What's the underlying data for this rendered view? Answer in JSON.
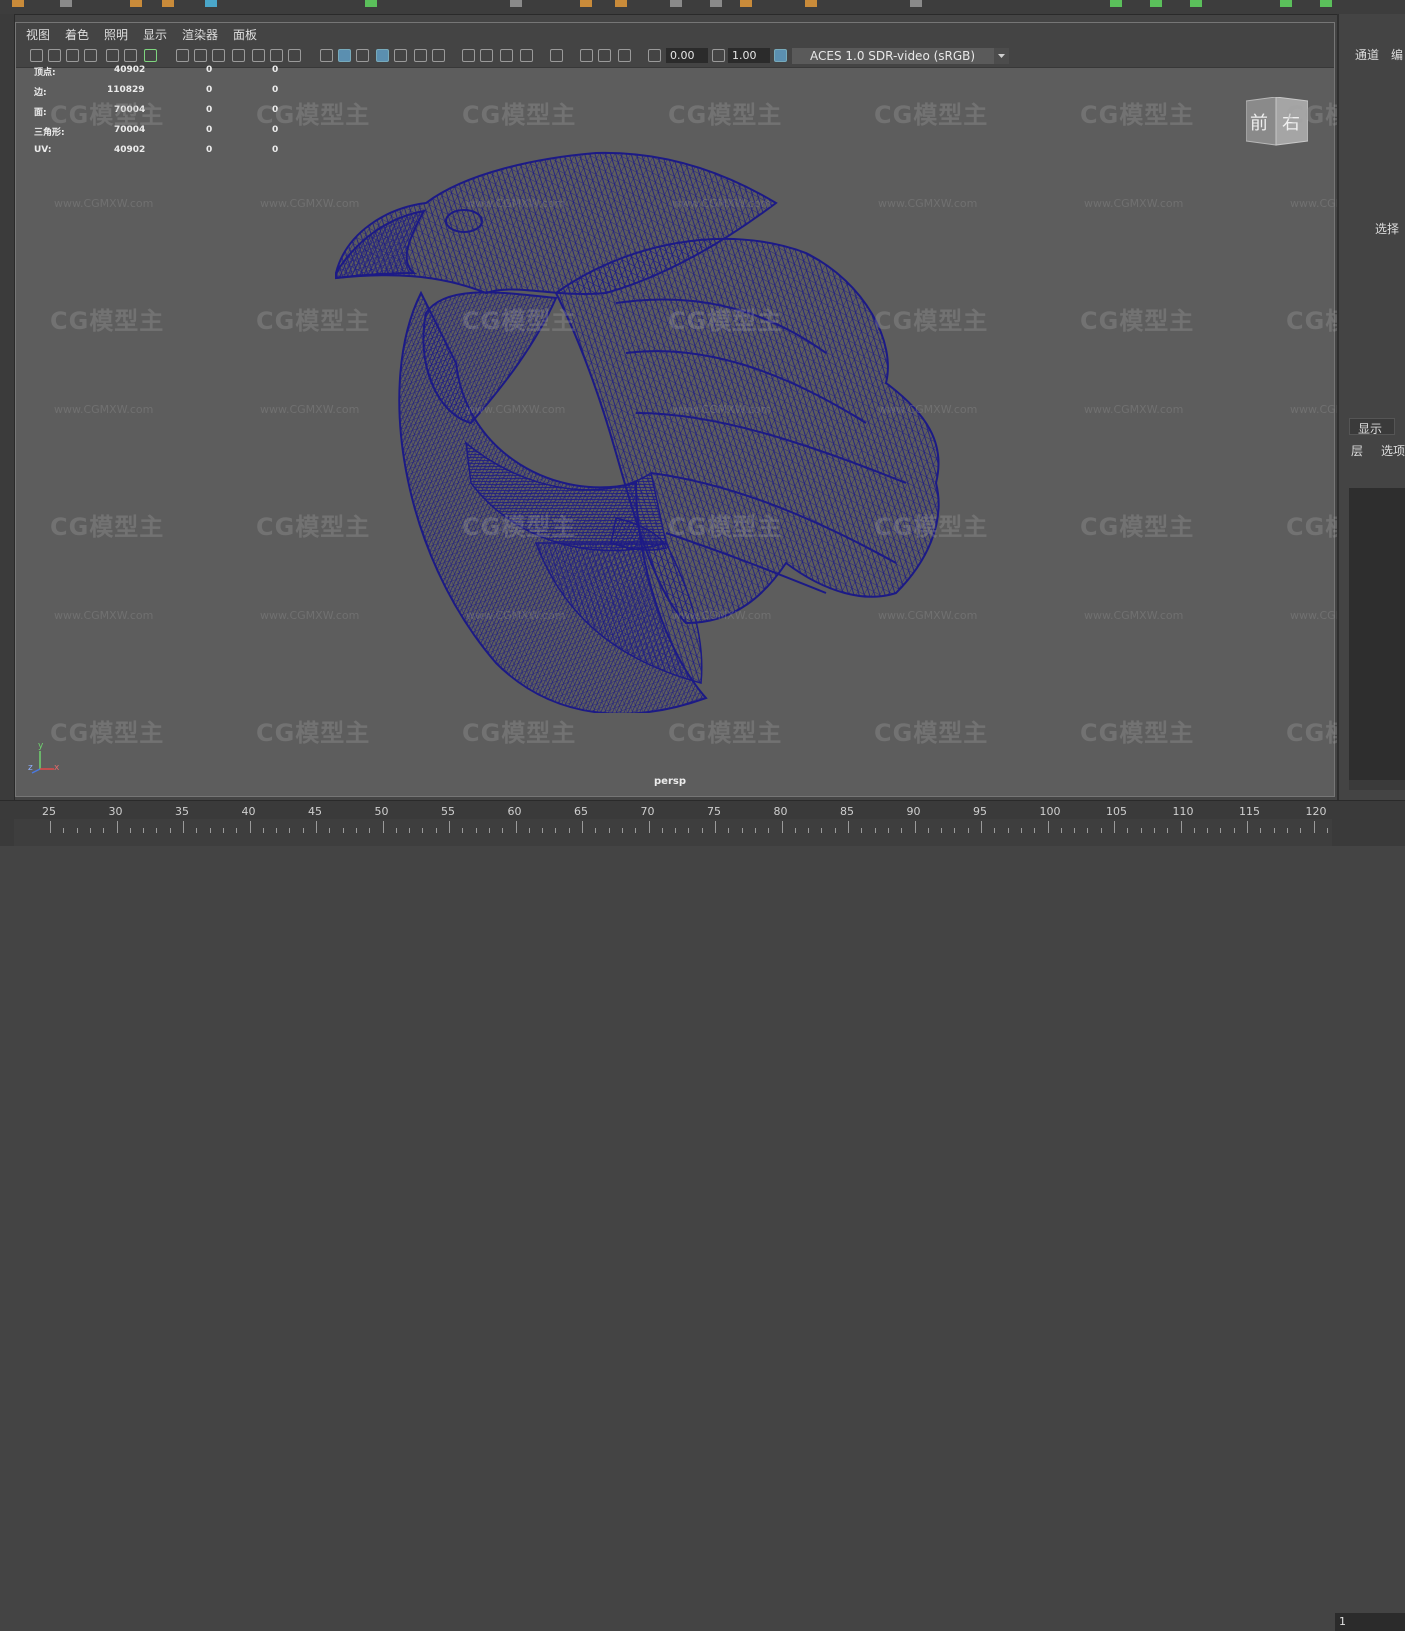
{
  "viewport": {
    "menu": [
      "视图",
      "着色",
      "照明",
      "显示",
      "渲染器",
      "面板"
    ],
    "exposure_value": "0.00",
    "gamma_value": "1.00",
    "color_space": "ACES 1.0 SDR-video (sRGB)",
    "camera_label": "persp"
  },
  "hud": {
    "rows": [
      {
        "label": "顶点:",
        "v1": "40902",
        "v2": "0",
        "v3": "0"
      },
      {
        "label": "边:",
        "v1": "110829",
        "v2": "0",
        "v3": "0"
      },
      {
        "label": "面:",
        "v1": "70004",
        "v2": "0",
        "v3": "0"
      },
      {
        "label": "三角形:",
        "v1": "70004",
        "v2": "0",
        "v3": "0"
      },
      {
        "label": "UV:",
        "v1": "40902",
        "v2": "0",
        "v3": "0"
      }
    ]
  },
  "viewcube": {
    "front": "前",
    "right": "右"
  },
  "axes": {
    "y": "y",
    "z": "z",
    "x": "x"
  },
  "watermark": {
    "logo_text": "CG模型主",
    "url_text": "www.CGMXW.com"
  },
  "right_panel": {
    "tabs": [
      "通道",
      "编"
    ],
    "select_label": "选择",
    "layer_tab": "显示",
    "layer_menu": [
      "层",
      "选项"
    ]
  },
  "timeline": {
    "labels": [
      "25",
      "30",
      "35",
      "40",
      "45",
      "50",
      "55",
      "60",
      "65",
      "70",
      "75",
      "80",
      "85",
      "90",
      "95",
      "100",
      "105",
      "110",
      "115",
      "120"
    ],
    "current_frame": "1"
  },
  "colors": {
    "wireframe": "#1c1a86",
    "viewport_bg": "#5d5d5d",
    "accent": "#5b8fb0"
  }
}
